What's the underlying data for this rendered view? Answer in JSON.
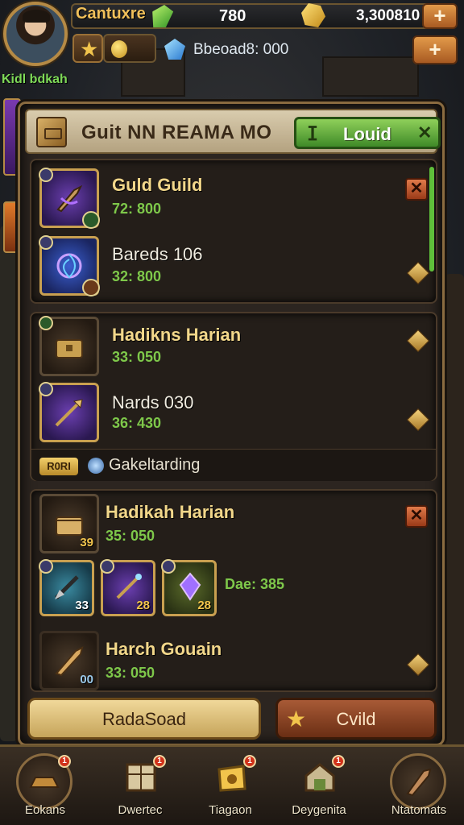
{
  "player": {
    "name": "Kidl bdkah"
  },
  "resources": {
    "name": "Cantuxre",
    "value1": "780",
    "value2": "3,300810",
    "value3": "Bbeoad8: 000",
    "plus_top": "+",
    "plus_second": "+"
  },
  "panel": {
    "title": "Guit NN REAMA MO",
    "header_button": {
      "icon": "ⵊ",
      "label": "Louid",
      "close": "✕"
    }
  },
  "section1": {
    "items": [
      {
        "name": "Guld Guild",
        "price": "72: 800",
        "icon": "dagger-icon"
      },
      {
        "name": "Bareds 106",
        "price": "32: 800",
        "icon": "vortex-icon"
      }
    ]
  },
  "section2": {
    "items": [
      {
        "name": "Hadikns Harian",
        "price": "33: 050",
        "icon": "chest-icon"
      },
      {
        "name": "Nards 030",
        "price": "36: 430",
        "icon": "spear-icon"
      }
    ],
    "guild_tag": "R0RI",
    "guild_label": "Gakeltarding"
  },
  "section3": {
    "item1": {
      "name": "Hadikah Harian",
      "price": "35: 050",
      "icon": "chest-icon",
      "count": "39"
    },
    "row": [
      {
        "count": "33",
        "icon": "arrow-icon"
      },
      {
        "count": "28",
        "icon": "wand-icon"
      },
      {
        "count": "28",
        "icon": "crystal-icon"
      }
    ],
    "row_label": "Dae: 385",
    "item2": {
      "name": "Harch Gouain",
      "price": "33: 050",
      "icon": "horn-icon",
      "count": "00"
    }
  },
  "buttons": {
    "left": "RadaSoad",
    "right": "Cvild"
  },
  "nav": [
    {
      "label": "Eokans",
      "badge": "1"
    },
    {
      "label": "Dwertec",
      "badge": "1"
    },
    {
      "label": "Tiagaon",
      "badge": "1"
    },
    {
      "label": "Deygenita",
      "badge": "1"
    },
    {
      "label": "Ntatomats",
      "badge": ""
    }
  ],
  "colors": {
    "accent_gold": "#f2d78a",
    "price_green": "#7ec84a",
    "header_green": "#5fbf3a"
  }
}
